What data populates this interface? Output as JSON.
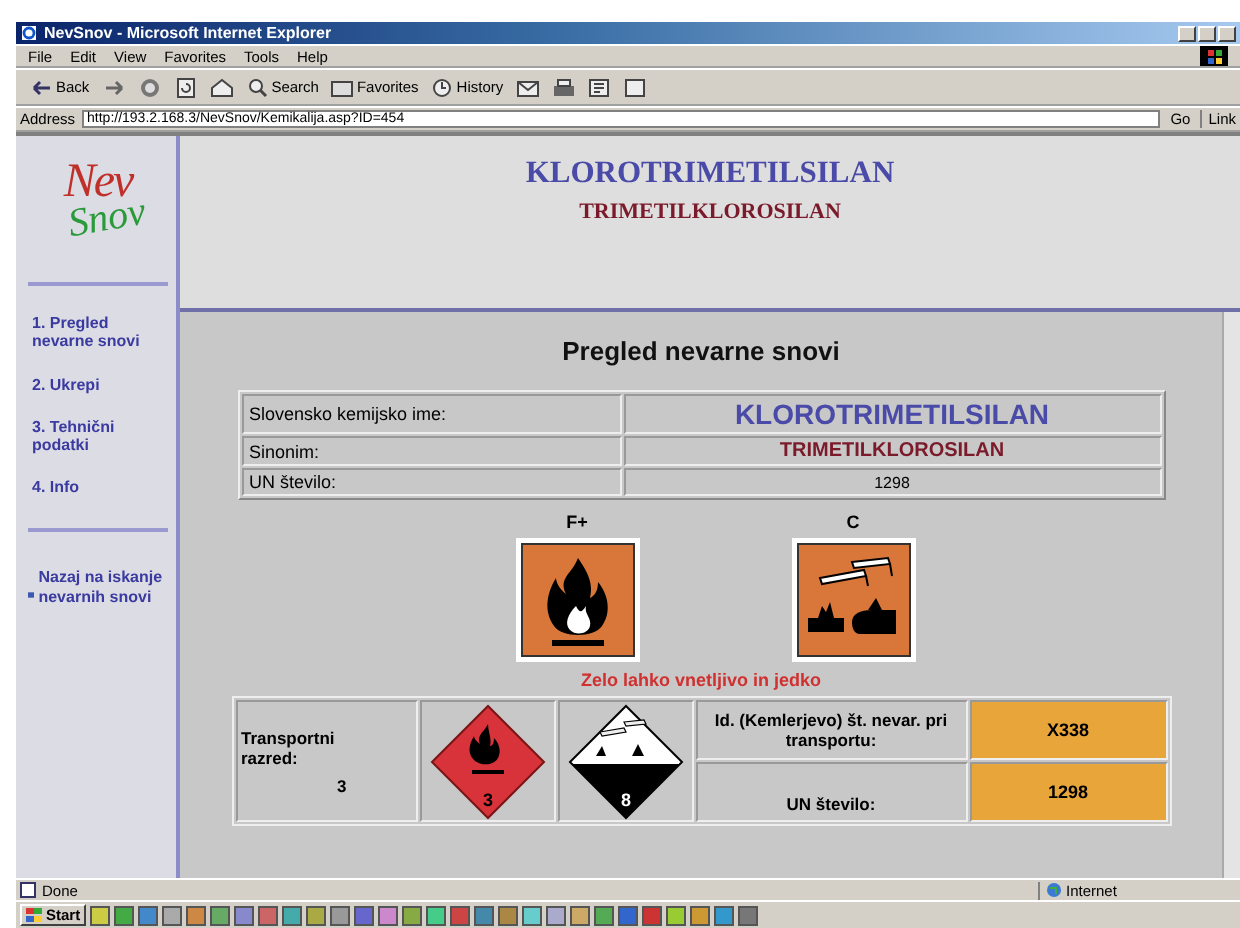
{
  "window": {
    "title": "NevSnov - Microsoft Internet Explorer"
  },
  "menu": [
    "File",
    "Edit",
    "View",
    "Favorites",
    "Tools",
    "Help"
  ],
  "toolbar": [
    {
      "kind": "back",
      "label": "Back"
    },
    {
      "kind": "forward"
    },
    {
      "kind": "stop"
    },
    {
      "kind": "refresh"
    },
    {
      "kind": "home"
    },
    {
      "kind": "search",
      "label": "Search"
    },
    {
      "kind": "favorites",
      "label": "Favorites"
    },
    {
      "kind": "history",
      "label": "History"
    },
    {
      "kind": "mail"
    },
    {
      "kind": "print"
    },
    {
      "kind": "edit"
    },
    {
      "kind": "discuss"
    }
  ],
  "address": {
    "label": "Address",
    "value": "http://193.2.168.3/NevSnov/Kemikalija.asp?ID=454",
    "go": "Go",
    "links": "Link"
  },
  "sidebar": {
    "logo": {
      "top": "Nev",
      "bottom": "Snov"
    },
    "items": [
      "1. Pregled nevarne snovi",
      "2. Ukrepi",
      "3. Tehnični podatki",
      "4. Info"
    ],
    "back_link": "Nazaj na iskanje nevarnih snovi"
  },
  "header": {
    "title": "KLOROTRIMETILSILAN",
    "subtitle": "TRIMETILKLOROSILAN"
  },
  "main": {
    "heading": "Pregled nevarne snovi",
    "info_rows": [
      {
        "kind": "name",
        "label": "Slovensko kemijsko ime:",
        "value": "KLOROTRIMETILSILAN"
      },
      {
        "kind": "synonym",
        "label": "Sinonim:",
        "value": "TRIMETILKLOROSILAN"
      },
      {
        "kind": "plain",
        "label": "UN število:",
        "value": "1298"
      }
    ],
    "pictograms": [
      {
        "kind": "flame",
        "code": "F+"
      },
      {
        "kind": "corrosive",
        "code": "C"
      }
    ],
    "hazard_text": "Zelo lahko vnetljivo in jedko",
    "transport": {
      "class_label": "Transportni razred:",
      "class_value": "3",
      "labels": [
        {
          "kind": "flame",
          "number": "3"
        },
        {
          "kind": "corrosive",
          "number": "8"
        }
      ],
      "kemler_label": "Id. (Kemlerjevo) št. nevar. pri transportu:",
      "kemler_value": "X338",
      "un_label": "UN število:",
      "un_value": "1298"
    }
  },
  "status_bar": {
    "text": "Done",
    "zone": "Internet"
  },
  "taskbar": {
    "start": "Start"
  }
}
